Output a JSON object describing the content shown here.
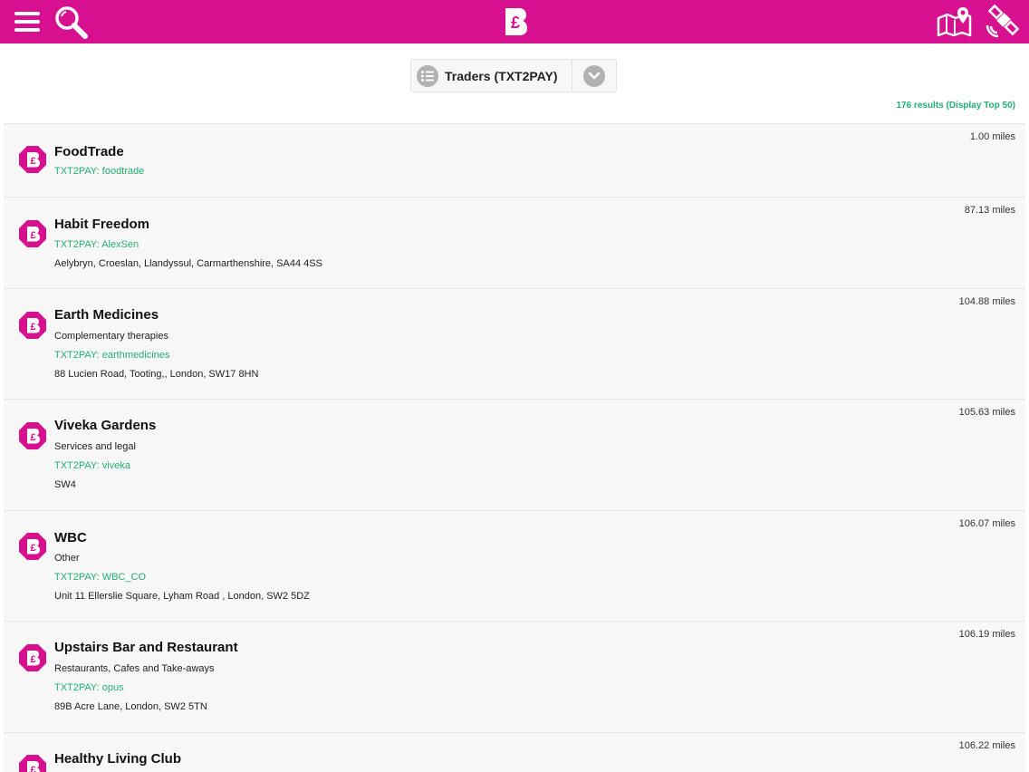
{
  "filter": {
    "label": "Traders (TXT2PAY)"
  },
  "results_count": "176 results (Display Top 50)",
  "colors": {
    "brand": "#d6108f",
    "accent_green": "#22b070",
    "row_bg": "#f7f7f7"
  },
  "icons": {
    "menu": "hamburger-menu-icon",
    "search": "magnifier-icon",
    "logo": "pound-b-logo-icon",
    "map": "map-pin-icon",
    "satellite": "satellite-icon",
    "trader": "pound-octagon-icon"
  },
  "traders": [
    {
      "name": "FoodTrade",
      "category": "",
      "code": "TXT2PAY: foodtrade",
      "address": "",
      "distance": "1.00 miles"
    },
    {
      "name": "Habit Freedom",
      "category": "",
      "code": "TXT2PAY: AlexSen",
      "address": "Aelybryn, Croeslan, Llandyssul, Carmarthenshire, SA44 4SS",
      "distance": "87.13 miles"
    },
    {
      "name": "Earth Medicines",
      "category": "Complementary therapies",
      "code": "TXT2PAY: earthmedicines",
      "address": "88 Lucien Road, Tooting,, London, SW17 8HN",
      "distance": "104.88 miles"
    },
    {
      "name": "Viveka Gardens",
      "category": "Services and legal",
      "code": "TXT2PAY: viveka",
      "address": "SW4",
      "distance": "105.63 miles"
    },
    {
      "name": "WBC",
      "category": "Other",
      "code": "TXT2PAY: WBC_CO",
      "address": "Unit 11 Ellerslie Square, Lyham Road , London, SW2 5DZ",
      "distance": "106.07 miles"
    },
    {
      "name": "Upstairs Bar and Restaurant",
      "category": "Restaurants, Cafes and Take-aways",
      "code": "TXT2PAY: opus",
      "address": "89B Acre Lane, London, SW2 5TN",
      "distance": "106.19 miles"
    },
    {
      "name": "Healthy Living Club",
      "category": "",
      "code": "",
      "address": "",
      "distance": "106.22 miles"
    }
  ]
}
